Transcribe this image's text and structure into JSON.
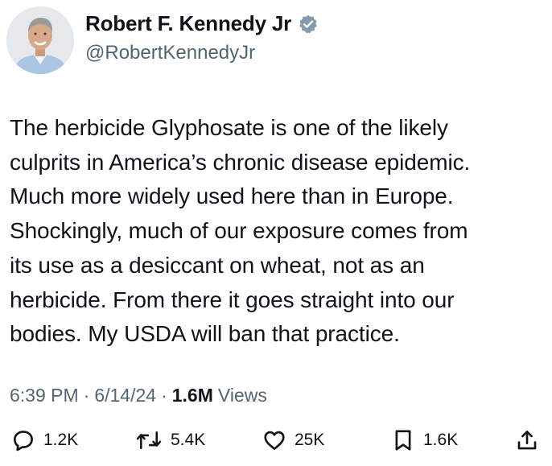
{
  "author": {
    "display_name": "Robert F. Kennedy Jr",
    "handle": "@RobertKennedyJr",
    "verified_icon": "verified-badge-icon",
    "avatar_icon": "avatar"
  },
  "tweet": {
    "text": "The herbicide Glyphosate is one of the likely\nculprits in America’s chronic disease epidemic.\nMuch more widely used here than in Europe.\nShockingly, much of our exposure comes from\nits use as a desiccant on wheat, not as an\nherbicide. From there it goes straight into our\nbodies. My USDA will ban that practice.",
    "time": "6:39 PM",
    "separator": "·",
    "date": "6/14/24",
    "views_count": "1.6M",
    "views_label": "Views"
  },
  "actions": {
    "replies": "1.2K",
    "reposts": "5.4K",
    "likes": "25K",
    "bookmarks": "1.6K"
  },
  "colors": {
    "text": "#0f1419",
    "secondary": "#536471",
    "verified": "#829aab"
  }
}
